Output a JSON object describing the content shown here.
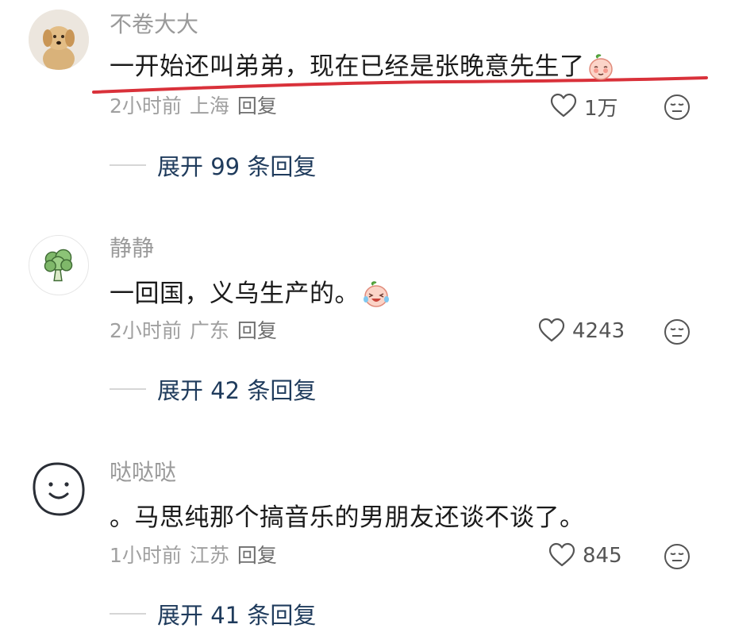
{
  "comments": [
    {
      "username": "不卷大大",
      "avatar_icon": "puppy-avatar-icon",
      "text": "一开始还叫弟弟，现在已经是张晚意先生了",
      "emoji_icon": "peach-shy-emoji-icon",
      "time": "2小时前",
      "location": "上海",
      "reply_label": "回复",
      "likes": "1万",
      "expand": "展开 99 条回复"
    },
    {
      "username": "静静",
      "avatar_icon": "broccoli-avatar-icon",
      "text": "一回国，义乌生产的。",
      "emoji_icon": "peach-laugh-cry-emoji-icon",
      "time": "2小时前",
      "location": "广东",
      "reply_label": "回复",
      "likes": "4243",
      "expand": "展开 42 条回复"
    },
    {
      "username": "哒哒哒",
      "avatar_icon": "smiley-sketch-avatar-icon",
      "text": "。马思纯那个搞音乐的男朋友还谈不谈了。",
      "time": "1小时前",
      "location": "江苏",
      "reply_label": "回复",
      "likes": "845",
      "expand": "展开 41 条回复"
    }
  ],
  "colors": {
    "annotation_underline": "#d9313a",
    "username": "#9a9a9a",
    "expand_text": "#1f3b5c",
    "body_text": "#1b1b1b"
  }
}
